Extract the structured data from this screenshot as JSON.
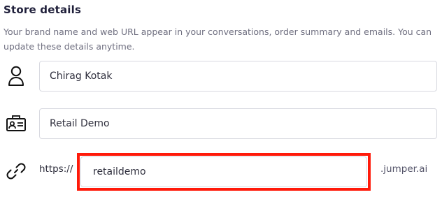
{
  "section": {
    "title": "Store details",
    "description": "Your brand name and web URL appear in your conversations, order summary and emails. You can update these details anytime."
  },
  "fields": {
    "owner_name": {
      "value": "Chirag Kotak",
      "icon": "user-icon"
    },
    "brand_name": {
      "value": "Retail Demo",
      "icon": "id-card-icon"
    },
    "store_url": {
      "prefix": "https://",
      "value": "retaildemo",
      "suffix": ".jumper.ai",
      "icon": "link-icon",
      "highlight_color": "#ff1a0a"
    }
  }
}
